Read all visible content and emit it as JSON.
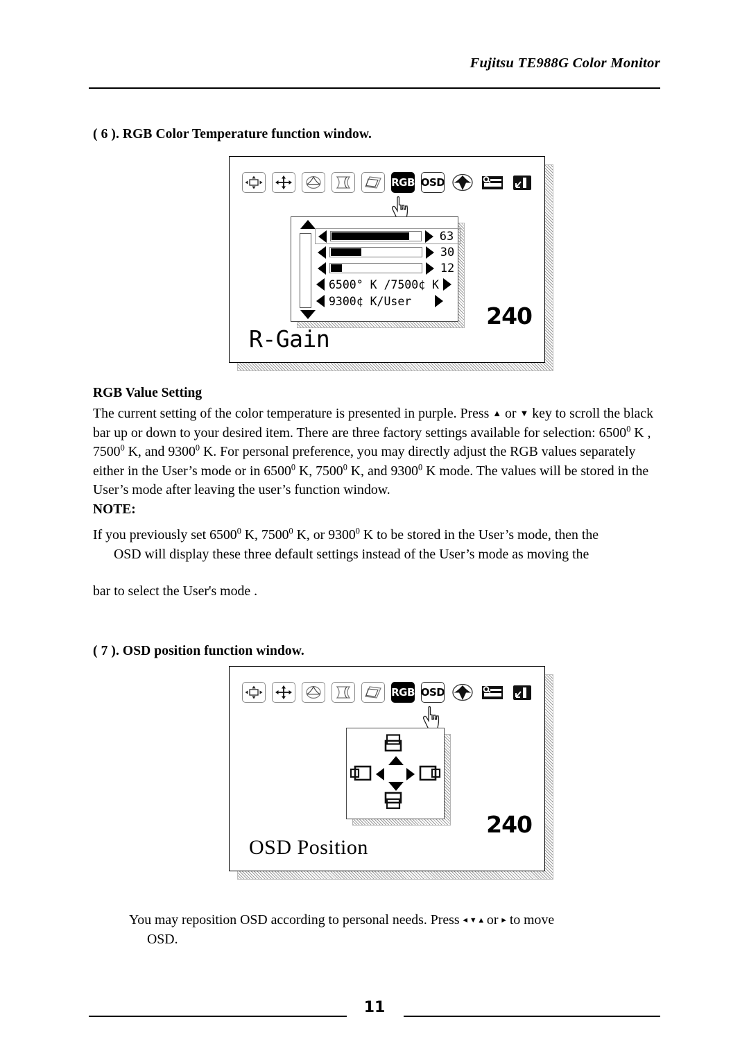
{
  "header": {
    "title": "Fujitsu TE988G Color Monitor"
  },
  "section6": {
    "heading": "( 6 ). RGB Color Temperature function window.",
    "diagram": {
      "icons": [
        {
          "name": "size-adjust-icon",
          "label": ""
        },
        {
          "name": "position-adjust-icon",
          "label": ""
        },
        {
          "name": "pincushion-icon",
          "label": ""
        },
        {
          "name": "barrel-distortion-icon",
          "label": ""
        },
        {
          "name": "parallelogram-icon",
          "label": ""
        },
        {
          "name": "rgb-icon",
          "label": "RGB",
          "selected": true
        },
        {
          "name": "osd-icon",
          "label": "OSD",
          "selected": false
        },
        {
          "name": "degauss-icon",
          "label": ""
        },
        {
          "name": "misc-settings-icon",
          "label": ""
        },
        {
          "name": "recall-icon",
          "label": ""
        }
      ],
      "rows": [
        {
          "value": "63",
          "fill_pct": 88,
          "highlight": true
        },
        {
          "value": "30",
          "fill_pct": 35,
          "highlight": false
        },
        {
          "value": "12",
          "fill_pct": 13,
          "highlight": false
        }
      ],
      "temp_rows": [
        {
          "text": "6500° K /7500¢ K",
          "right_arrow": true
        },
        {
          "text": "9300¢ K/User",
          "right_arrow": true
        }
      ],
      "label": "R-Gain",
      "value": "240"
    }
  },
  "rgb_value_setting": {
    "subheading": "RGB Value Setting",
    "paragraph_lines": [
      "The current setting of the color temperature is presented in purple. Press ▲ or ▼ key to scroll",
      "the black bar up or down to your desired item. There are three factory settings available for",
      "selection: 6500 0 K , 7500 0 K, and 9300 0 K. For personal preference, you may directly adjust",
      "the RGB values separately either in the User's mode or in 6500 0 K, 7500 0 K, and 9300 0 K",
      "mode. The values will be stored in the User's mode after leaving the user's function window."
    ]
  },
  "note": {
    "heading": "NOTE:",
    "line1": "If you previously set 6500",
    "line1b": " K, 7500",
    "line1c": " K, or 9300",
    "line1d": " K to be stored in the User's mode, then the",
    "line2": "OSD will display these three default settings instead of the User's mode as moving the",
    "line3": "bar to select the User's mode ."
  },
  "section7": {
    "heading": "( 7 ). OSD position function window.",
    "diagram": {
      "icons": [
        {
          "name": "size-adjust-icon",
          "label": ""
        },
        {
          "name": "position-adjust-icon",
          "label": ""
        },
        {
          "name": "pincushion-icon",
          "label": ""
        },
        {
          "name": "barrel-distortion-icon",
          "label": ""
        },
        {
          "name": "parallelogram-icon",
          "label": ""
        },
        {
          "name": "rgb-icon",
          "label": "RGB",
          "selected": true
        },
        {
          "name": "osd-icon",
          "label": "OSD",
          "selected": false
        },
        {
          "name": "degauss-icon",
          "label": ""
        },
        {
          "name": "misc-settings-icon",
          "label": ""
        },
        {
          "name": "recall-icon",
          "label": ""
        }
      ],
      "pad_icons": [
        {
          "name": "osd-move-up-icon"
        },
        {
          "name": "osd-move-left-icon"
        },
        {
          "name": "osd-move-right-icon"
        },
        {
          "name": "osd-move-down-icon"
        }
      ],
      "label": "OSD Position",
      "value": "240"
    },
    "paragraph_line1": "You may reposition OSD according to personal needs. Press ◂ ▾ ▴ or ▸ to move",
    "paragraph_line2": "OSD."
  },
  "footer": {
    "page_number": "11"
  },
  "colors": {
    "ink": "#000000",
    "rule": "#000000",
    "panel_border": "#4a4a4a",
    "shadow_hatch": "#9a9a9a"
  }
}
